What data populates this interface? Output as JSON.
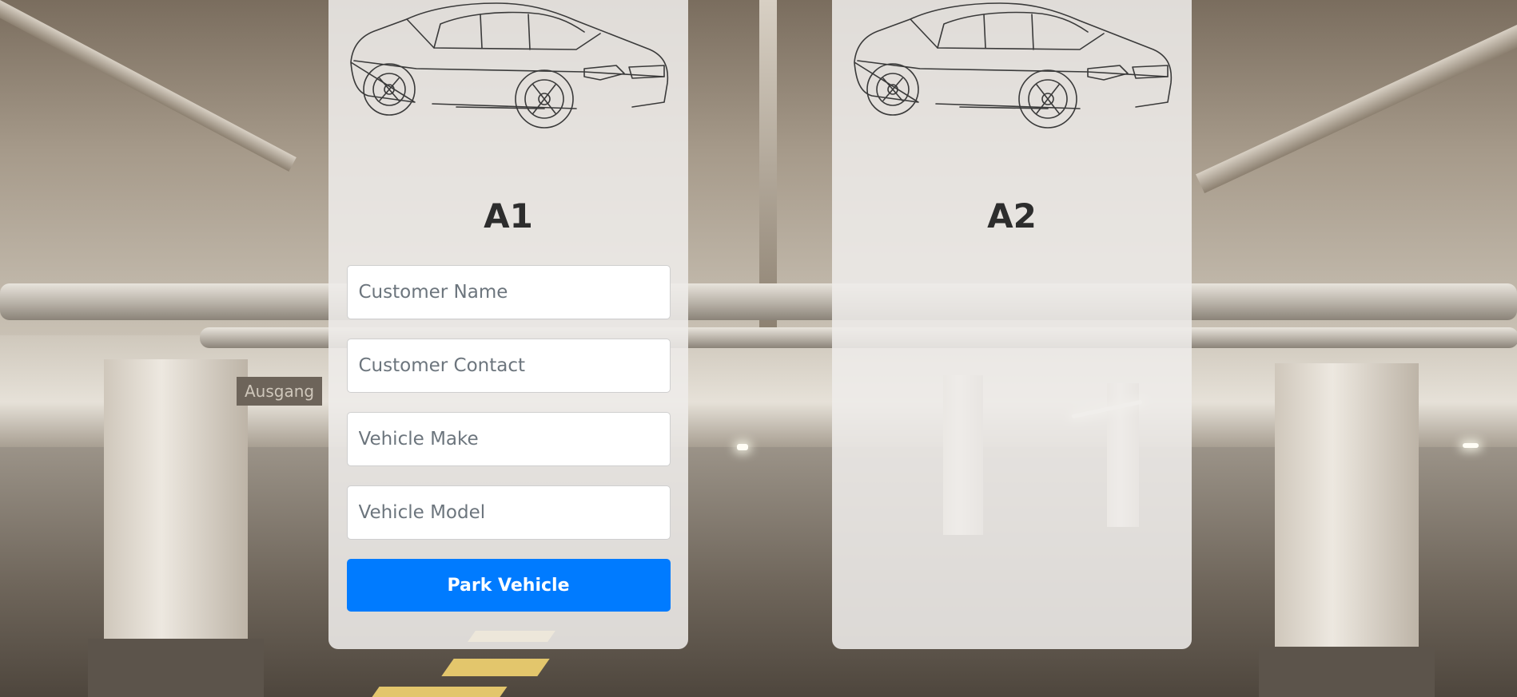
{
  "slots": [
    {
      "id": "A1",
      "state": "empty",
      "form": {
        "customer_name_placeholder": "Customer Name",
        "customer_contact_placeholder": "Customer Contact",
        "vehicle_make_placeholder": "Vehicle Make",
        "vehicle_model_placeholder": "Vehicle Model",
        "submit_label": "Park Vehicle"
      }
    },
    {
      "id": "A2",
      "state": "occupied-or-no-form"
    }
  ],
  "background_sign": "Ausgang",
  "colors": {
    "accent": "#007bff",
    "card_bg": "#eeece9",
    "title_text": "#2d2d2d"
  },
  "icons": {
    "car_illustration": "car-line-drawing-icon"
  }
}
